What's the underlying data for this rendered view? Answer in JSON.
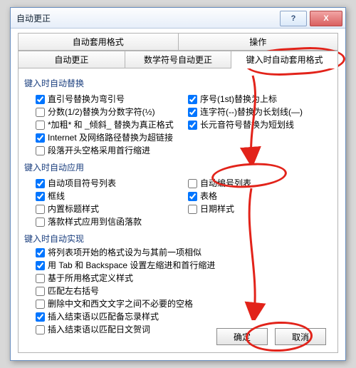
{
  "title": "自动更正",
  "winbtn": {
    "help": "?",
    "close": "X"
  },
  "tabs_row1": [
    "自动套用格式",
    "操作"
  ],
  "tabs_row2": [
    "自动更正",
    "数学符号自动更正",
    "键入时自动套用格式"
  ],
  "active_tab": "键入时自动套用格式",
  "sections": {
    "s1": {
      "title": "键入时自动替换",
      "left": [
        {
          "label": "直引号替换为弯引号",
          "checked": true
        },
        {
          "label": "分数(1/2)替换为分数字符(½)",
          "checked": false
        },
        {
          "label": "*加粗* 和 _倾斜_ 替换为真正格式",
          "checked": false
        },
        {
          "label": "Internet 及网络路径替换为超链接",
          "checked": true
        },
        {
          "label": "段落开头空格采用首行缩进",
          "checked": false
        }
      ],
      "right": [
        {
          "label": "序号(1st)替换为上标",
          "checked": true
        },
        {
          "label": "连字符(--)替换为长划线(—)",
          "checked": true
        },
        {
          "label": "长元音符号替换为短划线",
          "checked": true
        }
      ]
    },
    "s2": {
      "title": "键入时自动应用",
      "left": [
        {
          "label": "自动项目符号列表",
          "checked": true
        },
        {
          "label": "框线",
          "checked": true
        },
        {
          "label": "内置标题样式",
          "checked": false
        },
        {
          "label": "落款样式应用到信函落款",
          "checked": false
        }
      ],
      "right": [
        {
          "label": "自动编号列表",
          "checked": false,
          "hl": true
        },
        {
          "label": "表格",
          "checked": true
        },
        {
          "label": "日期样式",
          "checked": false
        }
      ]
    },
    "s3": {
      "title": "键入时自动实现",
      "items": [
        {
          "label": "将列表项开始的格式设为与其前一项相似",
          "checked": true
        },
        {
          "label": "用 Tab 和 Backspace 设置左缩进和首行缩进",
          "checked": true
        },
        {
          "label": "基于所用格式定义样式",
          "checked": false
        },
        {
          "label": "匹配左右括号",
          "checked": false
        },
        {
          "label": "删除中文和西文文字之间不必要的空格",
          "checked": false
        },
        {
          "label": "插入结束语以匹配备忘录样式",
          "checked": true
        },
        {
          "label": "插入结束语以匹配日文贺词",
          "checked": false
        }
      ]
    }
  },
  "buttons": {
    "ok": "确定",
    "cancel": "取消"
  }
}
